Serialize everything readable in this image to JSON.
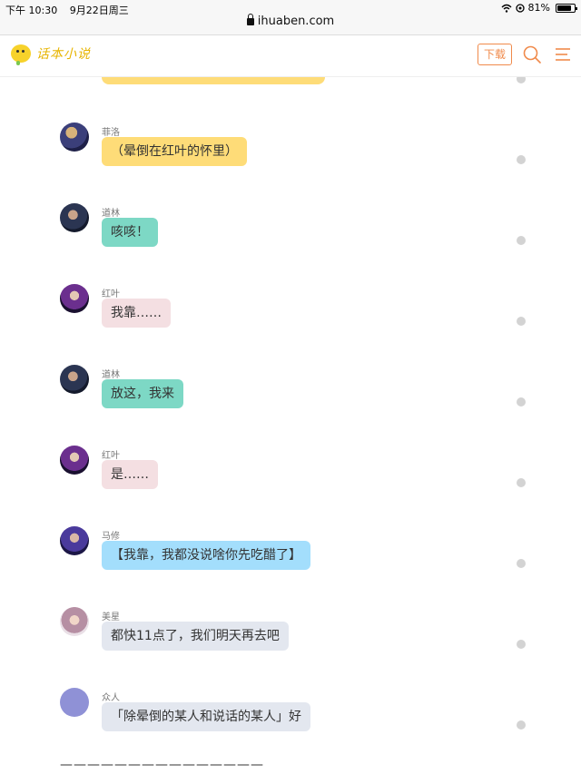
{
  "status_bar": {
    "time": "下午 10:30",
    "date": "9月22日周三",
    "battery": "81%",
    "url": "ihuaben.com"
  },
  "header": {
    "logo_text": "话本小说",
    "download_label": "下载"
  },
  "colors": {
    "accent": "#f08a4b",
    "yellow_bubble": "#fedc78",
    "teal_bubble": "#7dd8c5",
    "pink_bubble": "#f4dfe2",
    "blue_bubble": "#a3defc",
    "gray_bubble": "#e3e7ef"
  },
  "messages": [
    {
      "speaker": "菲洛",
      "text": "（晕倒在红叶的怀里）",
      "bubble_color": "yellow",
      "avatar": "feiluo-avatar"
    },
    {
      "speaker": "道林",
      "text": "咳咳！",
      "bubble_color": "teal",
      "avatar": "daolin-avatar"
    },
    {
      "speaker": "红叶",
      "text": "我靠……",
      "bubble_color": "pink",
      "avatar": "hongye-avatar"
    },
    {
      "speaker": "道林",
      "text": "放这，我来",
      "bubble_color": "teal",
      "avatar": "daolin-avatar"
    },
    {
      "speaker": "红叶",
      "text": "是……",
      "bubble_color": "pink",
      "avatar": "hongye-avatar"
    },
    {
      "speaker": "马修",
      "text": "【我靠，我都没说啥你先吃醋了】",
      "bubble_color": "blue",
      "avatar": "maxiu-avatar"
    },
    {
      "speaker": "美星",
      "text": "都快11点了，我们明天再去吧",
      "bubble_color": "gray",
      "avatar": "meixing-avatar"
    },
    {
      "speaker": "众人",
      "text": "「除晕倒的某人和说话的某人」好",
      "bubble_color": "gray",
      "avatar": "zhongren-avatar"
    }
  ],
  "separator": "———————————————"
}
